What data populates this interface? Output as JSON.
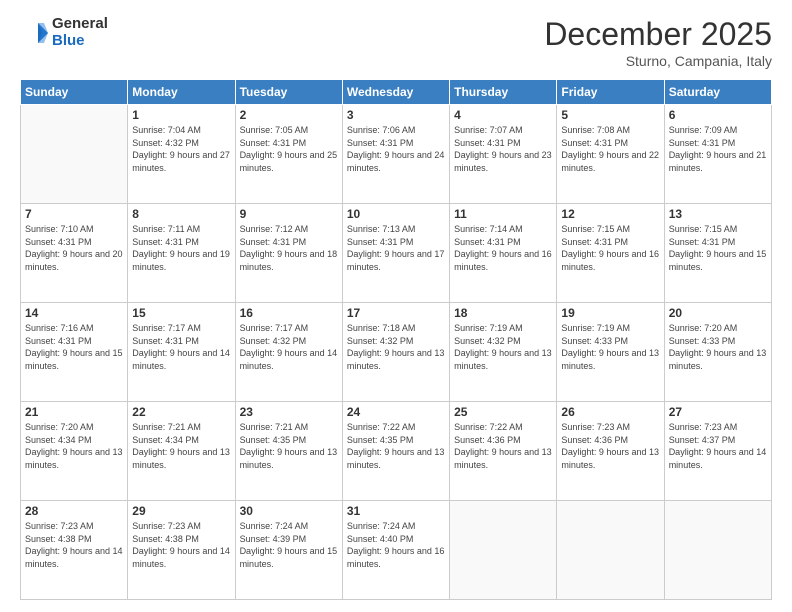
{
  "logo": {
    "general": "General",
    "blue": "Blue"
  },
  "header": {
    "month": "December 2025",
    "location": "Sturno, Campania, Italy"
  },
  "weekdays": [
    "Sunday",
    "Monday",
    "Tuesday",
    "Wednesday",
    "Thursday",
    "Friday",
    "Saturday"
  ],
  "weeks": [
    [
      {
        "day": "",
        "sunrise": "",
        "sunset": "",
        "daylight": ""
      },
      {
        "day": "1",
        "sunrise": "7:04 AM",
        "sunset": "4:32 PM",
        "daylight": "9 hours and 27 minutes."
      },
      {
        "day": "2",
        "sunrise": "7:05 AM",
        "sunset": "4:31 PM",
        "daylight": "9 hours and 25 minutes."
      },
      {
        "day": "3",
        "sunrise": "7:06 AM",
        "sunset": "4:31 PM",
        "daylight": "9 hours and 24 minutes."
      },
      {
        "day": "4",
        "sunrise": "7:07 AM",
        "sunset": "4:31 PM",
        "daylight": "9 hours and 23 minutes."
      },
      {
        "day": "5",
        "sunrise": "7:08 AM",
        "sunset": "4:31 PM",
        "daylight": "9 hours and 22 minutes."
      },
      {
        "day": "6",
        "sunrise": "7:09 AM",
        "sunset": "4:31 PM",
        "daylight": "9 hours and 21 minutes."
      }
    ],
    [
      {
        "day": "7",
        "sunrise": "7:10 AM",
        "sunset": "4:31 PM",
        "daylight": "9 hours and 20 minutes."
      },
      {
        "day": "8",
        "sunrise": "7:11 AM",
        "sunset": "4:31 PM",
        "daylight": "9 hours and 19 minutes."
      },
      {
        "day": "9",
        "sunrise": "7:12 AM",
        "sunset": "4:31 PM",
        "daylight": "9 hours and 18 minutes."
      },
      {
        "day": "10",
        "sunrise": "7:13 AM",
        "sunset": "4:31 PM",
        "daylight": "9 hours and 17 minutes."
      },
      {
        "day": "11",
        "sunrise": "7:14 AM",
        "sunset": "4:31 PM",
        "daylight": "9 hours and 16 minutes."
      },
      {
        "day": "12",
        "sunrise": "7:15 AM",
        "sunset": "4:31 PM",
        "daylight": "9 hours and 16 minutes."
      },
      {
        "day": "13",
        "sunrise": "7:15 AM",
        "sunset": "4:31 PM",
        "daylight": "9 hours and 15 minutes."
      }
    ],
    [
      {
        "day": "14",
        "sunrise": "7:16 AM",
        "sunset": "4:31 PM",
        "daylight": "9 hours and 15 minutes."
      },
      {
        "day": "15",
        "sunrise": "7:17 AM",
        "sunset": "4:31 PM",
        "daylight": "9 hours and 14 minutes."
      },
      {
        "day": "16",
        "sunrise": "7:17 AM",
        "sunset": "4:32 PM",
        "daylight": "9 hours and 14 minutes."
      },
      {
        "day": "17",
        "sunrise": "7:18 AM",
        "sunset": "4:32 PM",
        "daylight": "9 hours and 13 minutes."
      },
      {
        "day": "18",
        "sunrise": "7:19 AM",
        "sunset": "4:32 PM",
        "daylight": "9 hours and 13 minutes."
      },
      {
        "day": "19",
        "sunrise": "7:19 AM",
        "sunset": "4:33 PM",
        "daylight": "9 hours and 13 minutes."
      },
      {
        "day": "20",
        "sunrise": "7:20 AM",
        "sunset": "4:33 PM",
        "daylight": "9 hours and 13 minutes."
      }
    ],
    [
      {
        "day": "21",
        "sunrise": "7:20 AM",
        "sunset": "4:34 PM",
        "daylight": "9 hours and 13 minutes."
      },
      {
        "day": "22",
        "sunrise": "7:21 AM",
        "sunset": "4:34 PM",
        "daylight": "9 hours and 13 minutes."
      },
      {
        "day": "23",
        "sunrise": "7:21 AM",
        "sunset": "4:35 PM",
        "daylight": "9 hours and 13 minutes."
      },
      {
        "day": "24",
        "sunrise": "7:22 AM",
        "sunset": "4:35 PM",
        "daylight": "9 hours and 13 minutes."
      },
      {
        "day": "25",
        "sunrise": "7:22 AM",
        "sunset": "4:36 PM",
        "daylight": "9 hours and 13 minutes."
      },
      {
        "day": "26",
        "sunrise": "7:23 AM",
        "sunset": "4:36 PM",
        "daylight": "9 hours and 13 minutes."
      },
      {
        "day": "27",
        "sunrise": "7:23 AM",
        "sunset": "4:37 PM",
        "daylight": "9 hours and 14 minutes."
      }
    ],
    [
      {
        "day": "28",
        "sunrise": "7:23 AM",
        "sunset": "4:38 PM",
        "daylight": "9 hours and 14 minutes."
      },
      {
        "day": "29",
        "sunrise": "7:23 AM",
        "sunset": "4:38 PM",
        "daylight": "9 hours and 14 minutes."
      },
      {
        "day": "30",
        "sunrise": "7:24 AM",
        "sunset": "4:39 PM",
        "daylight": "9 hours and 15 minutes."
      },
      {
        "day": "31",
        "sunrise": "7:24 AM",
        "sunset": "4:40 PM",
        "daylight": "9 hours and 16 minutes."
      },
      {
        "day": "",
        "sunrise": "",
        "sunset": "",
        "daylight": ""
      },
      {
        "day": "",
        "sunrise": "",
        "sunset": "",
        "daylight": ""
      },
      {
        "day": "",
        "sunrise": "",
        "sunset": "",
        "daylight": ""
      }
    ]
  ],
  "labels": {
    "sunrise": "Sunrise:",
    "sunset": "Sunset:",
    "daylight": "Daylight:"
  }
}
